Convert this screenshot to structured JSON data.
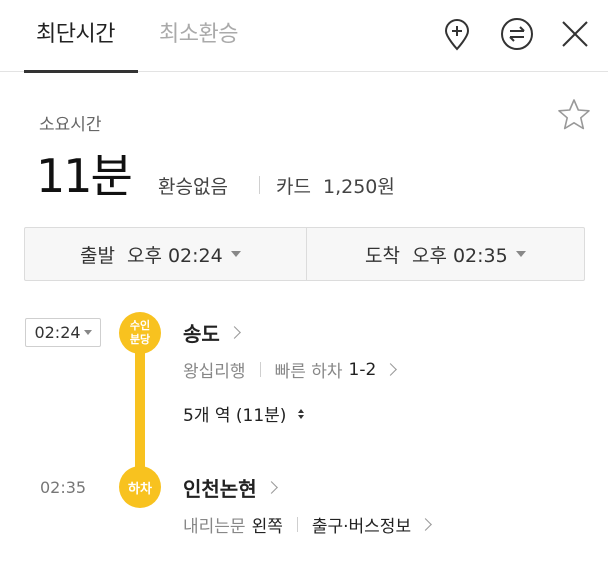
{
  "tabs": [
    {
      "label": "최단시간",
      "active": true
    },
    {
      "label": "최소환승",
      "active": false
    }
  ],
  "header_icons": [
    "add-location-icon",
    "swap-icon",
    "close-icon"
  ],
  "summary": {
    "duration_label": "소요시간",
    "duration": "11분",
    "transfer": "환승없음",
    "fare_label": "카드",
    "fare_value": "1,250원"
  },
  "time_selector": {
    "departure_label": "출발",
    "departure_time": "오후 02:24",
    "arrival_label": "도착",
    "arrival_time": "오후 02:35"
  },
  "route": {
    "start": {
      "time": "02:24",
      "badge_line1": "수인",
      "badge_line2": "분당",
      "station": "송도",
      "direction": "왕십리행",
      "fast_exit_label": "빠른 하차",
      "fast_exit_value": "1-2"
    },
    "stops": "5개 역 (11분)",
    "end": {
      "time": "02:35",
      "badge": "하차",
      "station": "인천논현",
      "door_label": "내리는문",
      "door_value": "왼쪽",
      "exit_info": "출구·버스정보"
    }
  },
  "colors": {
    "line_accent": "#f8c21f",
    "text_primary": "#222222",
    "text_secondary": "#888888"
  }
}
